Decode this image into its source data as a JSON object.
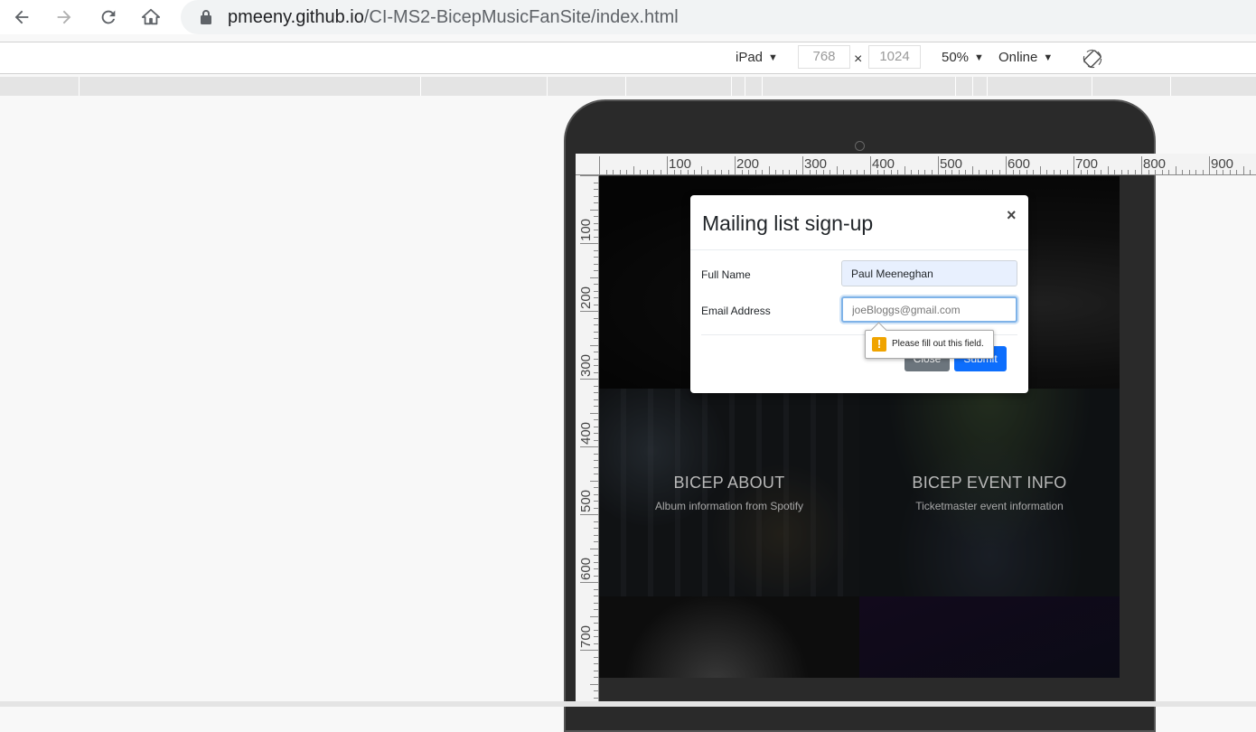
{
  "browser": {
    "url_host": "pmeeny.github.io",
    "url_path": "/CI-MS2-BicepMusicFanSite/index.html",
    "icons": [
      "back-arrow-icon",
      "forward-arrow-icon",
      "reload-icon",
      "home-icon",
      "lock-icon"
    ]
  },
  "device_toolbar": {
    "device": "iPad",
    "width": "768",
    "x_sign": "×",
    "height": "1024",
    "zoom": "50%",
    "throttle": "Online",
    "rotate_icon": "rotate-icon"
  },
  "ruler": {
    "h_labels": [
      "100",
      "200",
      "300",
      "400",
      "500",
      "600",
      "700",
      "800",
      "900"
    ],
    "v_labels": [
      "100",
      "200",
      "300",
      "400",
      "500",
      "600",
      "700"
    ]
  },
  "page": {
    "tiles": [
      {
        "title": "BICEP ABOUT",
        "subtitle": "Album information from Spotify"
      },
      {
        "title": "BICEP EVENT INFO",
        "subtitle": "Ticketmaster event information"
      }
    ]
  },
  "modal": {
    "title": "Mailing list sign-up",
    "close_glyph": "×",
    "name_label": "Full Name",
    "name_value": "Paul Meeneghan",
    "email_label": "Email Address",
    "email_placeholder": "joeBloggs@gmail.com",
    "close_button": "Close",
    "submit_button": "Submit"
  },
  "validation": {
    "icon": "!",
    "message": "Please fill out this field."
  }
}
